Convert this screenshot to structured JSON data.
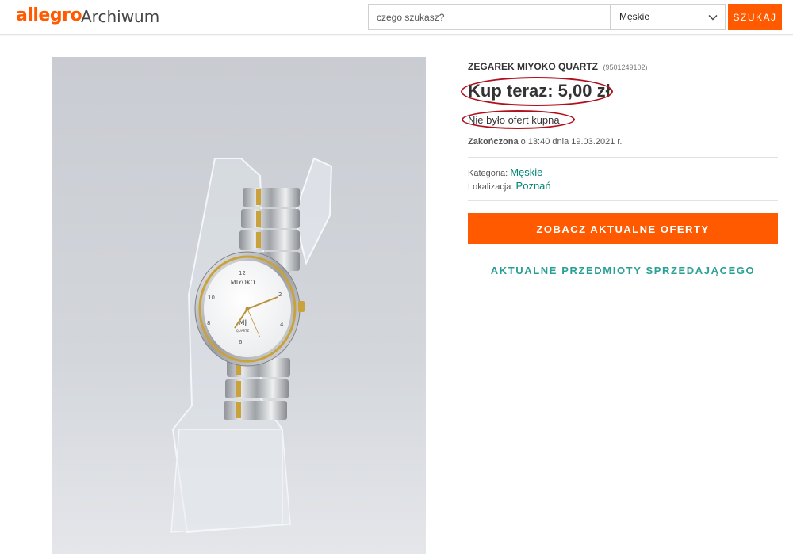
{
  "header": {
    "logo_text": "allegro",
    "section_title": "Archiwum",
    "search": {
      "placeholder": "czego szukasz?",
      "value": ""
    },
    "category_select": {
      "selected": "Męskie",
      "icon": "chevron-down-icon"
    },
    "search_button_label": "SZUKAJ",
    "accent_color": "#ff5a00"
  },
  "product": {
    "title": "ZEGAREK MIYOKO QUARTZ",
    "item_id": "(9501249102)",
    "price_text": "Kup teraz: 5,00 zł",
    "offers_text": "Nie było ofert kupna",
    "ended_label": "Zakończona",
    "ended_detail": "o 13:40 dnia 19.03.2021 r.",
    "category_label": "Kategoria:",
    "category_value": "Męskie",
    "location_label": "Lokalizacja:",
    "location_value": "Poznań",
    "image": {
      "dial_brand": "MIYOKO",
      "dial_text": "QUARTZ",
      "dial_logo": "MJ"
    }
  },
  "actions": {
    "see_current_offers": "ZOBACZ AKTUALNE OFERTY",
    "seller_items": "AKTUALNE PRZEDMIOTY SPRZEDAJĄCEGO"
  },
  "colors": {
    "highlight_ring": "#b0101c",
    "link_teal": "#008673",
    "seller_link": "#2aa094"
  }
}
